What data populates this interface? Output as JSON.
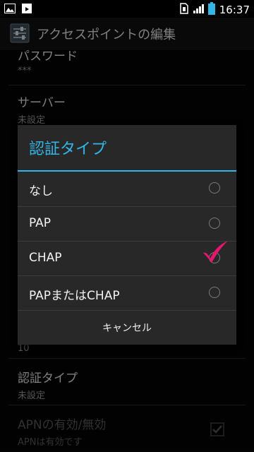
{
  "status_bar": {
    "time": "16:37"
  },
  "action_bar": {
    "title": "アクセスポイントの編集"
  },
  "background_prefs": [
    {
      "title": "パスワード",
      "summary": "***"
    },
    {
      "title": "サーバー",
      "summary": "未設定"
    },
    {
      "summary": "10"
    },
    {
      "title": "認証タイプ",
      "summary": "未設定"
    },
    {
      "title": "APNの有効/無効",
      "summary": "APNは有効です"
    }
  ],
  "dialog": {
    "title": "認証タイプ",
    "options": [
      "なし",
      "PAP",
      "CHAP",
      "PAPまたはCHAP"
    ],
    "selected": "CHAP",
    "cancel": "キャンセル"
  },
  "colors": {
    "accent": "#33b5e5",
    "check": "#e6176e"
  },
  "icons": [
    "image-icon",
    "download-icon",
    "sim-icon",
    "signal-icon",
    "battery-icon",
    "app-settings-icon",
    "checkbox-icon",
    "checkmark-icon"
  ]
}
